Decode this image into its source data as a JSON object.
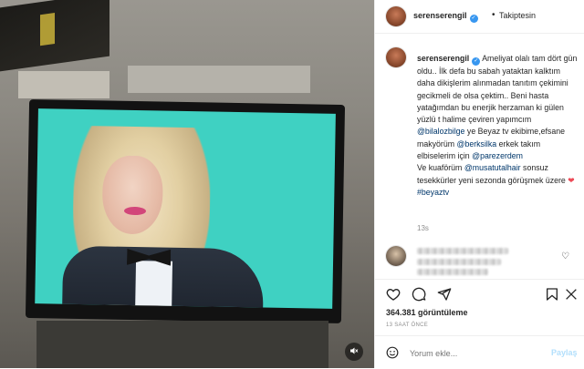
{
  "media": {
    "mute_icon": "speaker-muted-icon"
  },
  "header": {
    "username": "serenserengil",
    "separator": "•",
    "follow_label": "Takiptesin",
    "verified_icon": "verified-badge-icon"
  },
  "caption": {
    "username": "serenserengil",
    "line1": "Ameliyat olalı tam dört gün oldu.. İlk defa bu sabah yataktan kalktım daha dikişlerim alınmadan tanıtım çekimini gecikmeli de olsa çektim.. Beni hasta yatağımdan bu enerjik herzaman ki gülen yüzlü t halime çeviren yapımcım",
    "mention1": "@bilalozbilge",
    "t1": "ye Beyaz tv ekibime,efsane makyörüm",
    "mention2": "@berksilka",
    "t2": "erkek takım elbiselerim için",
    "mention3": "@parezerdem",
    "t3": "Ve kuaförüm",
    "mention4": "@musatutalhair",
    "t4": "sonsuz tesekkürler yeni sezonda görüşmek üzere",
    "heart": "❤",
    "hashtag": "#beyaztv",
    "timestamp": "13s"
  },
  "actions": {
    "like_icon": "heart-icon",
    "comment_icon": "comment-icon",
    "share_icon": "share-icon",
    "save_icon": "bookmark-icon",
    "more_icon": "more-icon",
    "views": "364.381 görüntüleme",
    "time_ago": "13 SAAT ÖNCE"
  },
  "comment_box": {
    "placeholder": "Yorum ekle...",
    "post_label": "Paylaş",
    "emoji_icon": "emoji-icon"
  },
  "colors": {
    "accent": "#3897f0",
    "link": "#00376b",
    "heart": "#ed4956",
    "muted": "#8e8e8e"
  }
}
